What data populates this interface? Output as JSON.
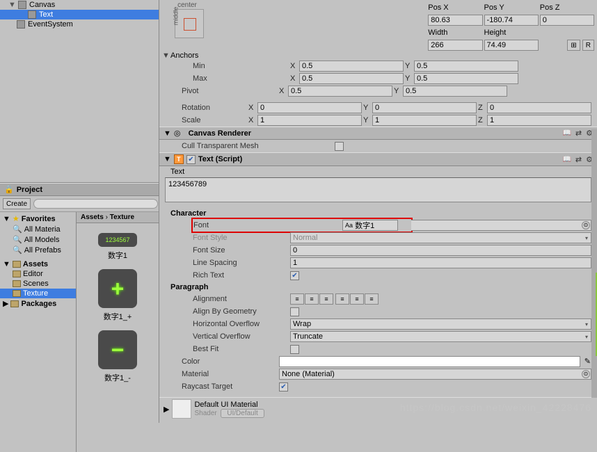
{
  "hierarchy": {
    "items": [
      {
        "label": "Canvas",
        "indent": 0,
        "fold": "▼"
      },
      {
        "label": "Text",
        "indent": 1,
        "selected": true
      },
      {
        "label": "EventSystem",
        "indent": 0
      }
    ]
  },
  "project": {
    "tab_label": "Project",
    "create_label": "Create",
    "favorites_label": "Favorites",
    "fav_items": [
      "All Materia",
      "All Models",
      "All Prefabs"
    ],
    "assets_label": "Assets",
    "asset_folders": [
      "Editor",
      "Scenes",
      "Texture"
    ],
    "selected_folder": "Texture",
    "packages_label": "Packages",
    "breadcrumb": [
      "Assets",
      "Texture"
    ],
    "thumbs": [
      {
        "name": "数字1",
        "type": "bar"
      },
      {
        "name": "数字1_+",
        "type": "plus"
      },
      {
        "name": "数字1_-",
        "type": "minus"
      }
    ]
  },
  "transform": {
    "center_label": "center",
    "middle_label": "middle",
    "posx_label": "Pos X",
    "posx": "80.63",
    "posy_label": "Pos Y",
    "posy": "-180.74",
    "posz_label": "Pos Z",
    "posz": "0",
    "width_label": "Width",
    "width": "266",
    "height_label": "Height",
    "height": "74.49",
    "anchors_label": "Anchors",
    "min_label": "Min",
    "min_x": "0.5",
    "min_y": "0.5",
    "max_label": "Max",
    "max_x": "0.5",
    "max_y": "0.5",
    "pivot_label": "Pivot",
    "pivot_x": "0.5",
    "pivot_y": "0.5",
    "rotation_label": "Rotation",
    "rot_x": "0",
    "rot_y": "0",
    "rot_z": "0",
    "scale_label": "Scale",
    "scale_x": "1",
    "scale_y": "1",
    "scale_z": "1",
    "x_label": "X",
    "y_label": "Y",
    "z_label": "Z",
    "reset_btn": "R"
  },
  "canvas_renderer": {
    "title": "Canvas Renderer",
    "cull_label": "Cull Transparent Mesh",
    "cull_checked": false
  },
  "text_component": {
    "title": "Text (Script)",
    "enabled": true,
    "text_label": "Text",
    "text_value": "123456789",
    "character_label": "Character",
    "font_label": "Font",
    "font_value": "数字1",
    "font_style_label": "Font Style",
    "font_style_value": "Normal",
    "font_size_label": "Font Size",
    "font_size_value": "0",
    "line_spacing_label": "Line Spacing",
    "line_spacing_value": "1",
    "rich_text_label": "Rich Text",
    "rich_text_checked": true,
    "paragraph_label": "Paragraph",
    "alignment_label": "Alignment",
    "align_geom_label": "Align By Geometry",
    "align_geom_checked": false,
    "h_overflow_label": "Horizontal Overflow",
    "h_overflow_value": "Wrap",
    "v_overflow_label": "Vertical Overflow",
    "v_overflow_value": "Truncate",
    "best_fit_label": "Best Fit",
    "best_fit_checked": false,
    "color_label": "Color",
    "material_label": "Material",
    "material_value": "None (Material)",
    "raycast_label": "Raycast Target",
    "raycast_checked": true
  },
  "default_material": {
    "title": "Default UI Material",
    "shader_label": "Shader",
    "shader_value": "UI/Default"
  },
  "watermark": "https://blog.csdn.net/weixin_42228476"
}
